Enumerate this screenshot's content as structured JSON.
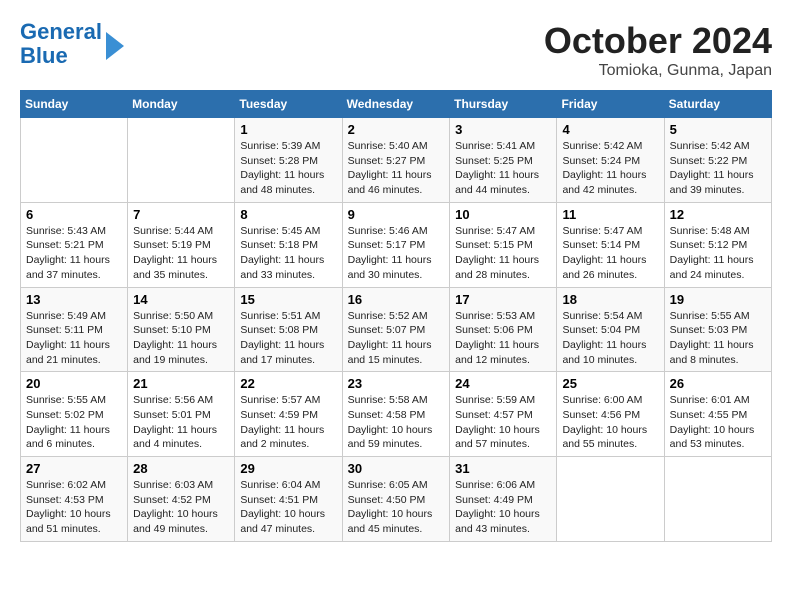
{
  "logo": {
    "line1": "General",
    "line2": "Blue"
  },
  "title": "October 2024",
  "subtitle": "Tomioka, Gunma, Japan",
  "days_of_week": [
    "Sunday",
    "Monday",
    "Tuesday",
    "Wednesday",
    "Thursday",
    "Friday",
    "Saturday"
  ],
  "weeks": [
    [
      {
        "day": "",
        "info": ""
      },
      {
        "day": "",
        "info": ""
      },
      {
        "day": "1",
        "info": "Sunrise: 5:39 AM\nSunset: 5:28 PM\nDaylight: 11 hours and 48 minutes."
      },
      {
        "day": "2",
        "info": "Sunrise: 5:40 AM\nSunset: 5:27 PM\nDaylight: 11 hours and 46 minutes."
      },
      {
        "day": "3",
        "info": "Sunrise: 5:41 AM\nSunset: 5:25 PM\nDaylight: 11 hours and 44 minutes."
      },
      {
        "day": "4",
        "info": "Sunrise: 5:42 AM\nSunset: 5:24 PM\nDaylight: 11 hours and 42 minutes."
      },
      {
        "day": "5",
        "info": "Sunrise: 5:42 AM\nSunset: 5:22 PM\nDaylight: 11 hours and 39 minutes."
      }
    ],
    [
      {
        "day": "6",
        "info": "Sunrise: 5:43 AM\nSunset: 5:21 PM\nDaylight: 11 hours and 37 minutes."
      },
      {
        "day": "7",
        "info": "Sunrise: 5:44 AM\nSunset: 5:19 PM\nDaylight: 11 hours and 35 minutes."
      },
      {
        "day": "8",
        "info": "Sunrise: 5:45 AM\nSunset: 5:18 PM\nDaylight: 11 hours and 33 minutes."
      },
      {
        "day": "9",
        "info": "Sunrise: 5:46 AM\nSunset: 5:17 PM\nDaylight: 11 hours and 30 minutes."
      },
      {
        "day": "10",
        "info": "Sunrise: 5:47 AM\nSunset: 5:15 PM\nDaylight: 11 hours and 28 minutes."
      },
      {
        "day": "11",
        "info": "Sunrise: 5:47 AM\nSunset: 5:14 PM\nDaylight: 11 hours and 26 minutes."
      },
      {
        "day": "12",
        "info": "Sunrise: 5:48 AM\nSunset: 5:12 PM\nDaylight: 11 hours and 24 minutes."
      }
    ],
    [
      {
        "day": "13",
        "info": "Sunrise: 5:49 AM\nSunset: 5:11 PM\nDaylight: 11 hours and 21 minutes."
      },
      {
        "day": "14",
        "info": "Sunrise: 5:50 AM\nSunset: 5:10 PM\nDaylight: 11 hours and 19 minutes."
      },
      {
        "day": "15",
        "info": "Sunrise: 5:51 AM\nSunset: 5:08 PM\nDaylight: 11 hours and 17 minutes."
      },
      {
        "day": "16",
        "info": "Sunrise: 5:52 AM\nSunset: 5:07 PM\nDaylight: 11 hours and 15 minutes."
      },
      {
        "day": "17",
        "info": "Sunrise: 5:53 AM\nSunset: 5:06 PM\nDaylight: 11 hours and 12 minutes."
      },
      {
        "day": "18",
        "info": "Sunrise: 5:54 AM\nSunset: 5:04 PM\nDaylight: 11 hours and 10 minutes."
      },
      {
        "day": "19",
        "info": "Sunrise: 5:55 AM\nSunset: 5:03 PM\nDaylight: 11 hours and 8 minutes."
      }
    ],
    [
      {
        "day": "20",
        "info": "Sunrise: 5:55 AM\nSunset: 5:02 PM\nDaylight: 11 hours and 6 minutes."
      },
      {
        "day": "21",
        "info": "Sunrise: 5:56 AM\nSunset: 5:01 PM\nDaylight: 11 hours and 4 minutes."
      },
      {
        "day": "22",
        "info": "Sunrise: 5:57 AM\nSunset: 4:59 PM\nDaylight: 11 hours and 2 minutes."
      },
      {
        "day": "23",
        "info": "Sunrise: 5:58 AM\nSunset: 4:58 PM\nDaylight: 10 hours and 59 minutes."
      },
      {
        "day": "24",
        "info": "Sunrise: 5:59 AM\nSunset: 4:57 PM\nDaylight: 10 hours and 57 minutes."
      },
      {
        "day": "25",
        "info": "Sunrise: 6:00 AM\nSunset: 4:56 PM\nDaylight: 10 hours and 55 minutes."
      },
      {
        "day": "26",
        "info": "Sunrise: 6:01 AM\nSunset: 4:55 PM\nDaylight: 10 hours and 53 minutes."
      }
    ],
    [
      {
        "day": "27",
        "info": "Sunrise: 6:02 AM\nSunset: 4:53 PM\nDaylight: 10 hours and 51 minutes."
      },
      {
        "day": "28",
        "info": "Sunrise: 6:03 AM\nSunset: 4:52 PM\nDaylight: 10 hours and 49 minutes."
      },
      {
        "day": "29",
        "info": "Sunrise: 6:04 AM\nSunset: 4:51 PM\nDaylight: 10 hours and 47 minutes."
      },
      {
        "day": "30",
        "info": "Sunrise: 6:05 AM\nSunset: 4:50 PM\nDaylight: 10 hours and 45 minutes."
      },
      {
        "day": "31",
        "info": "Sunrise: 6:06 AM\nSunset: 4:49 PM\nDaylight: 10 hours and 43 minutes."
      },
      {
        "day": "",
        "info": ""
      },
      {
        "day": "",
        "info": ""
      }
    ]
  ]
}
